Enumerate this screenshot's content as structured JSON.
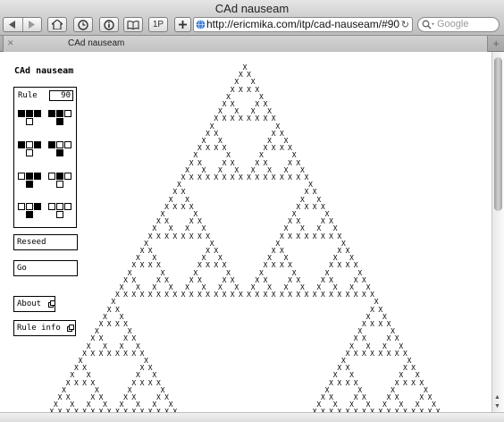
{
  "window": {
    "title": "CAd nauseam"
  },
  "toolbar": {
    "topsites_label": "1P",
    "url": "http://ericmika.com/itp/cad-nauseam/#90",
    "search_placeholder": "Google"
  },
  "tabs": [
    {
      "label": "CAd nauseam"
    }
  ],
  "page": {
    "title": "CAd nauseam",
    "rule_label": "Rule",
    "rule_value": "90",
    "rules": [
      {
        "pattern": [
          1,
          1,
          1
        ],
        "result": 0
      },
      {
        "pattern": [
          1,
          1,
          0
        ],
        "result": 1
      },
      {
        "pattern": [
          1,
          0,
          1
        ],
        "result": 0
      },
      {
        "pattern": [
          1,
          0,
          0
        ],
        "result": 1
      },
      {
        "pattern": [
          0,
          1,
          1
        ],
        "result": 1
      },
      {
        "pattern": [
          0,
          1,
          0
        ],
        "result": 0
      },
      {
        "pattern": [
          0,
          0,
          1
        ],
        "result": 1
      },
      {
        "pattern": [
          0,
          0,
          0
        ],
        "result": 0
      }
    ],
    "buttons": {
      "reseed": "Reseed",
      "go": "Go",
      "about": "About",
      "rule_info": "Rule info"
    },
    "automaton": {
      "rule": 90,
      "cell_char": "X"
    }
  }
}
